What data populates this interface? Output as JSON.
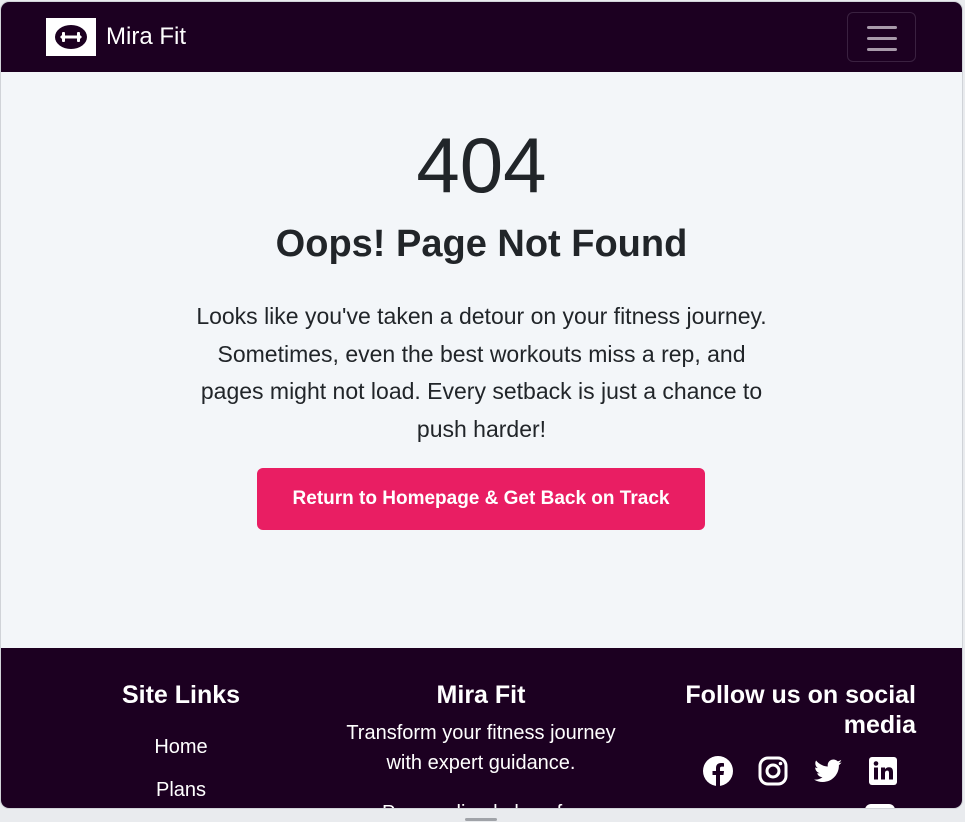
{
  "navbar": {
    "brand_name": "Mira Fit",
    "logo_icon": "dumbbell-icon",
    "toggle_icon": "hamburger-menu-icon"
  },
  "main": {
    "code": "404",
    "title": "Oops! Page Not Found",
    "message": "Looks like you've taken a detour on your fitness journey. Sometimes, even the best workouts miss a rep, and pages might not load. Every setback is just a chance to push harder!",
    "button_label": "Return to Homepage & Get Back on Track"
  },
  "footer": {
    "site_links": {
      "title": "Site Links",
      "items": [
        "Home",
        "Plans"
      ]
    },
    "about": {
      "title": "Mira Fit",
      "tagline": "Transform your fitness journey with expert guidance.",
      "more_text": "Personalized plans for"
    },
    "social": {
      "title": "Follow us on social media",
      "icons": [
        "facebook-icon",
        "instagram-icon",
        "twitter-icon",
        "linkedin-icon",
        "youtube-icon"
      ]
    }
  },
  "colors": {
    "nav_bg": "#1c0021",
    "page_bg": "#f3f6f9",
    "accent": "#e91e63",
    "text": "#212529"
  }
}
